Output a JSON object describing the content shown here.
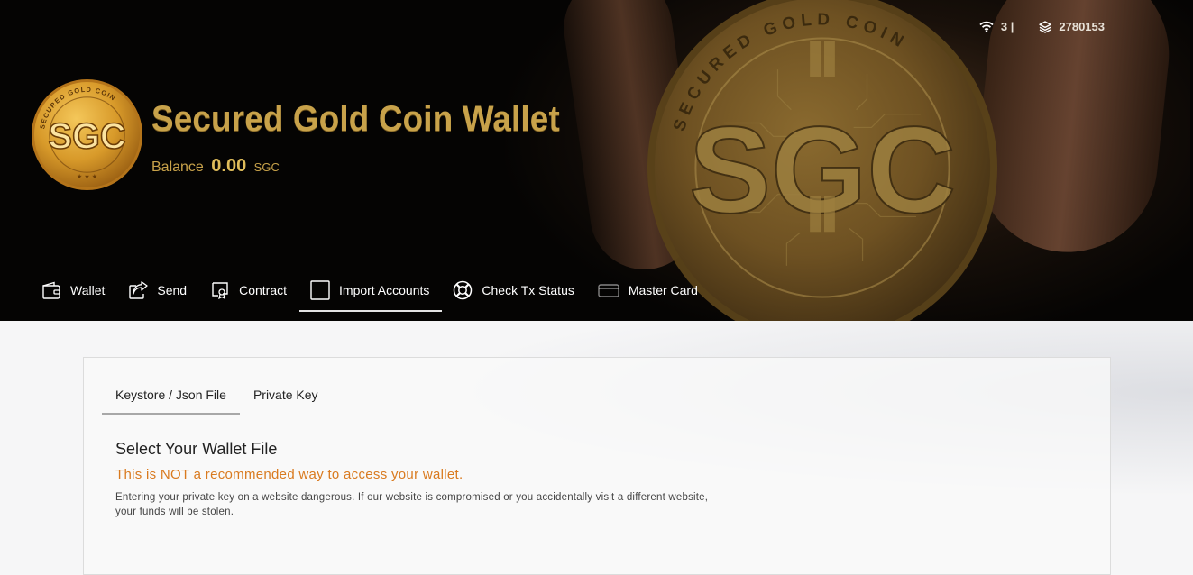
{
  "app": {
    "title": "Secured Gold Coin Wallet",
    "balance_label": "Balance",
    "balance_value": "0.00",
    "balance_unit": "SGC",
    "logo_text": "SGC",
    "logo_ring_text": "SECURED GOLD COIN",
    "hero_coin_text": "SGC",
    "hero_ring_text": "SECURED GOLD COIN"
  },
  "status": {
    "peers": "3 |",
    "block_height": "2780153",
    "peers_icon": "wifi-icon",
    "block_icon": "layers-icon"
  },
  "nav": {
    "items": [
      {
        "label": "Wallet",
        "icon": "wallet-icon"
      },
      {
        "label": "Send",
        "icon": "share-icon"
      },
      {
        "label": "Contract",
        "icon": "contract-icon"
      },
      {
        "label": "Import Accounts",
        "icon": "import-icon",
        "active": true
      },
      {
        "label": "Check Tx Status",
        "icon": "lifebuoy-icon"
      },
      {
        "label": "Master Card",
        "icon": "card-icon"
      }
    ]
  },
  "import": {
    "tabs": [
      {
        "label": "Keystore / Json File",
        "active": true
      },
      {
        "label": "Private Key"
      }
    ],
    "heading": "Select Your Wallet File",
    "warning": "This is NOT a recommended way to access your wallet.",
    "warning_detail": "Entering your private key on a website dangerous. If our website is compromised or you accidentally visit a different website, your funds will be stolen."
  },
  "colors": {
    "gold": "#c8a24a",
    "warning": "#d97a1f",
    "header_bg": "#050403"
  }
}
